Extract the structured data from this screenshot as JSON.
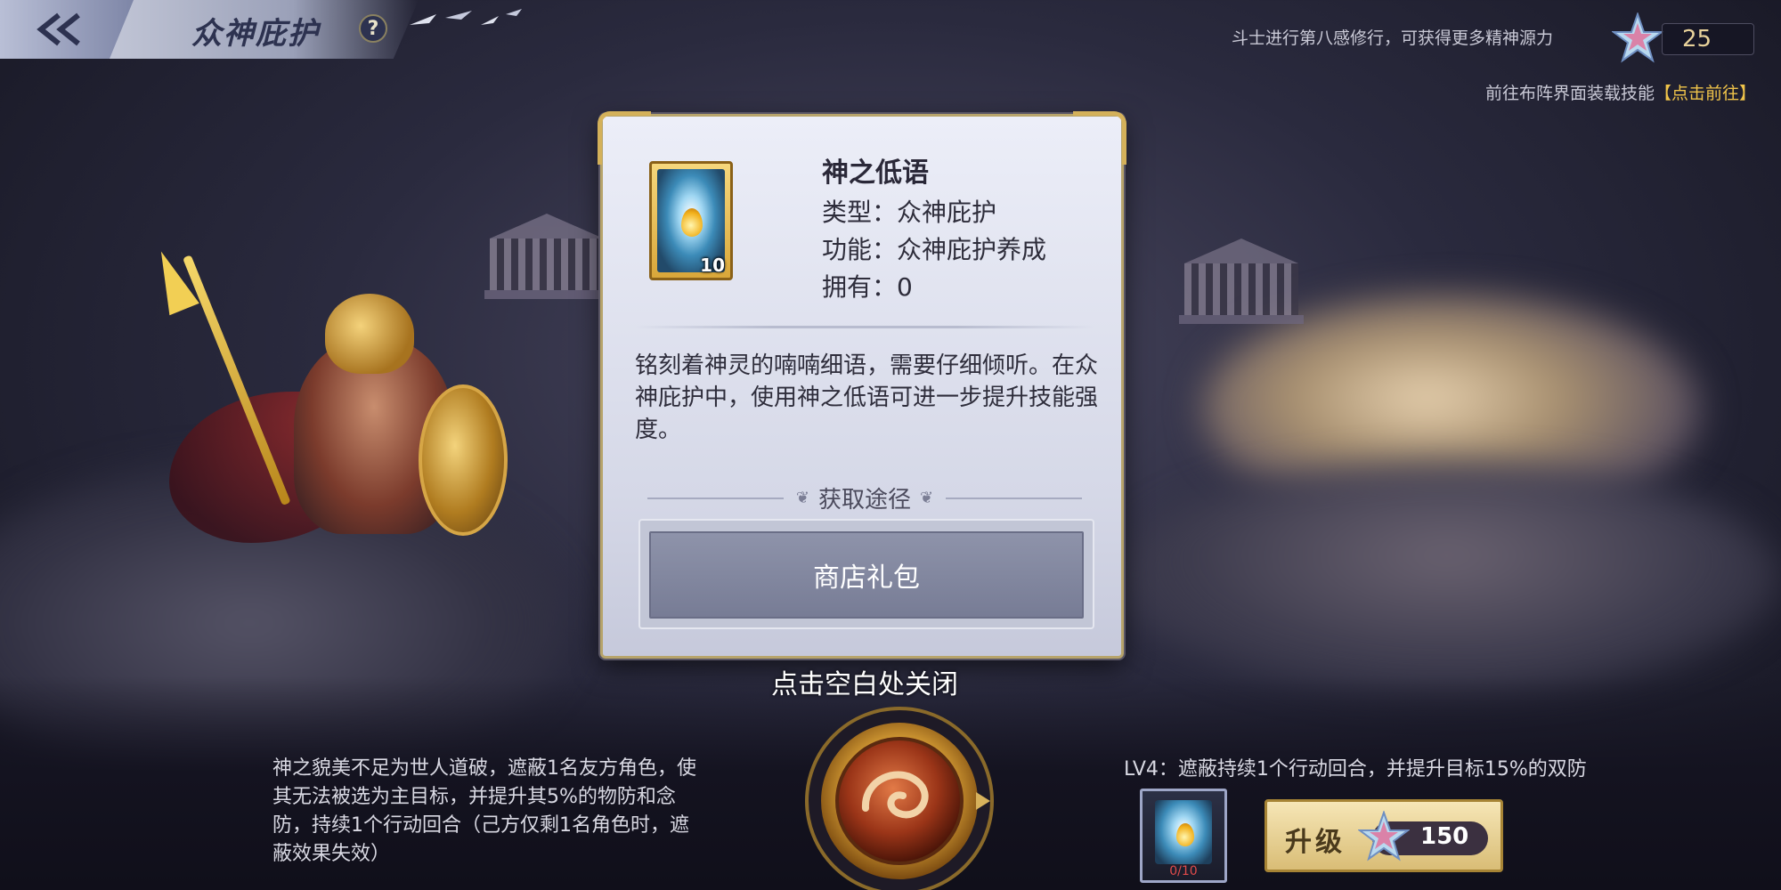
{
  "header": {
    "title": "众神庇护",
    "help_symbol": "?"
  },
  "top_right": {
    "hint": "斗士进行第八感修行，可获得更多精神源力",
    "currency_value": "25",
    "goto_text": "前往布阵界面装载技能",
    "goto_link": "【点击前往】"
  },
  "popup": {
    "item_name": "神之低语",
    "item_count": "10",
    "type_line": "类型：众神庇护",
    "function_line": "功能：众神庇护养成",
    "owned_line": "拥有：0",
    "description": "铭刻着神灵的喃喃细语，需要仔细倾听。在众神庇护中，使用神之低语可进一步提升技能强度。",
    "source_header": "获取途径",
    "source_button": "商店礼包"
  },
  "close_hint": "点击空白处关闭",
  "bottom": {
    "skill_description": "神之貌美不足为世人道破，遮蔽1名友方角色，使其无法被选为主目标，并提升其5%的物防和念防，持续1个行动回合（己方仅剩1名角色时，遮蔽效果失效）",
    "level_effect": "LV4：遮蔽持续1个行动回合，并提升目标15%的双防",
    "material_progress": "0/10",
    "upgrade_label": "升级",
    "upgrade_cost": "150"
  },
  "icons": {
    "back": "double-chevron-left-icon",
    "help": "question-icon",
    "currency": "star-icon",
    "item": "whisper-drop-icon",
    "skill": "skill-orb-icon"
  }
}
